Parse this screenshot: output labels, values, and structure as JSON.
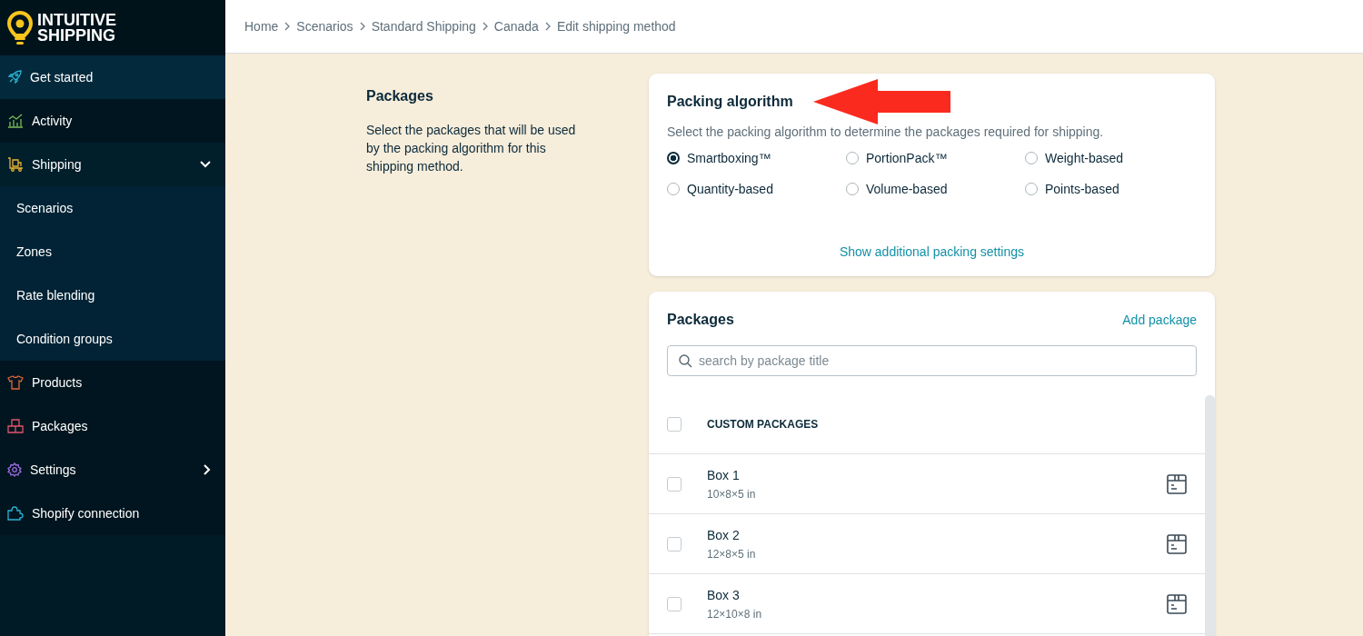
{
  "logo": {
    "line1": "INTUITIVE",
    "line2": "SHIPPING"
  },
  "sidebar": {
    "items": [
      {
        "label": "Get started",
        "kind": "rocket",
        "selected": true
      },
      {
        "label": "Activity",
        "kind": "chart",
        "selected": false
      },
      {
        "label": "Shipping",
        "kind": "truck",
        "selected": false,
        "expanded": true,
        "children": [
          {
            "label": "Scenarios"
          },
          {
            "label": "Zones"
          },
          {
            "label": "Rate blending"
          },
          {
            "label": "Condition groups"
          }
        ]
      },
      {
        "label": "Products",
        "kind": "shirt",
        "selected": false
      },
      {
        "label": "Packages",
        "kind": "boxes",
        "selected": false
      },
      {
        "label": "Settings",
        "kind": "gear",
        "selected": false,
        "expanded": false
      },
      {
        "label": "Shopify connection",
        "kind": "puzzle",
        "selected": false
      }
    ]
  },
  "breadcrumb": [
    "Home",
    "Scenarios",
    "Standard Shipping",
    "Canada",
    "Edit shipping method"
  ],
  "section": {
    "title": "Packages",
    "description": "Select the packages that will be used by the packing algorithm for this shipping method."
  },
  "packing_algorithm": {
    "title": "Packing algorithm",
    "description": "Select the packing algorithm to determine the packages required for shipping.",
    "options": [
      {
        "label": "Smartboxing™",
        "selected": true
      },
      {
        "label": "PortionPack™",
        "selected": false
      },
      {
        "label": "Weight-based",
        "selected": false
      },
      {
        "label": "Quantity-based",
        "selected": false
      },
      {
        "label": "Volume-based",
        "selected": false
      },
      {
        "label": "Points-based",
        "selected": false
      }
    ],
    "link": "Show additional packing settings"
  },
  "packages": {
    "title": "Packages",
    "add_link": "Add package",
    "search": {
      "placeholder": "search by package title"
    },
    "header": {
      "label": "CUSTOM PACKAGES",
      "checked": false
    },
    "rows": [
      {
        "name": "Box 1",
        "size": "10×8×5 in",
        "checked": false
      },
      {
        "name": "Box 2",
        "size": "12×8×5 in",
        "checked": false
      },
      {
        "name": "Box 3",
        "size": "12×10×8 in",
        "checked": false
      }
    ]
  }
}
